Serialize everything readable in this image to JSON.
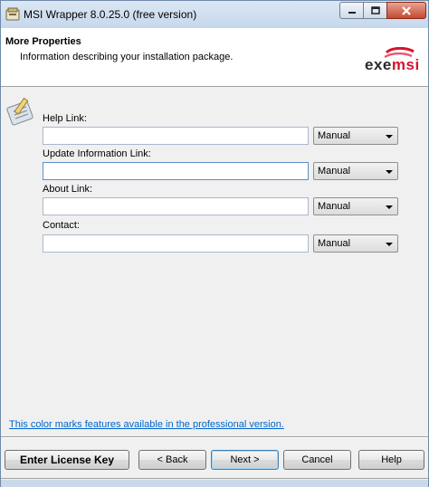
{
  "window": {
    "title": "MSI Wrapper 8.0.25.0 (free version)"
  },
  "header": {
    "title": "More Properties",
    "subtitle": "Information describing your installation package.",
    "logo_part1": "exe",
    "logo_part2": "msi"
  },
  "fields": [
    {
      "label": "Help Link:",
      "value": "",
      "mode": "Manual"
    },
    {
      "label": "Update Information Link:",
      "value": "",
      "mode": "Manual"
    },
    {
      "label": "About Link:",
      "value": "",
      "mode": "Manual"
    },
    {
      "label": "Contact:",
      "value": "",
      "mode": "Manual"
    }
  ],
  "pro_note": "This color marks features available in the professional version.",
  "buttons": {
    "license": "Enter License Key",
    "back": "< Back",
    "next": "Next >",
    "cancel": "Cancel",
    "help": "Help"
  },
  "colors": {
    "link": "#0066cc",
    "logo_accent": "#d7142e"
  }
}
